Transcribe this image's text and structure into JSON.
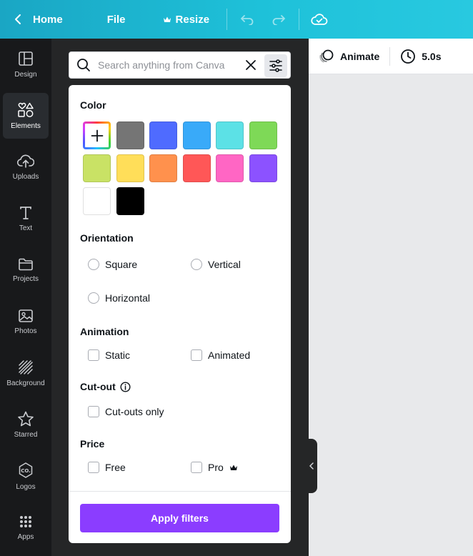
{
  "topbar": {
    "home_label": "Home",
    "file_label": "File",
    "resize_label": "Resize"
  },
  "rail": [
    {
      "label": "Design",
      "icon": "layout-icon",
      "active": false
    },
    {
      "label": "Elements",
      "icon": "shapes-icon",
      "active": true
    },
    {
      "label": "Uploads",
      "icon": "cloud-upload-icon",
      "active": false
    },
    {
      "label": "Text",
      "icon": "text-icon",
      "active": false
    },
    {
      "label": "Projects",
      "icon": "folder-icon",
      "active": false
    },
    {
      "label": "Photos",
      "icon": "image-icon",
      "active": false
    },
    {
      "label": "Background",
      "icon": "pattern-icon",
      "active": false
    },
    {
      "label": "Starred",
      "icon": "star-icon",
      "active": false
    },
    {
      "label": "Logos",
      "icon": "logo-icon",
      "active": false
    },
    {
      "label": "Apps",
      "icon": "grid-icon",
      "active": false
    }
  ],
  "search": {
    "placeholder": "Search anything from Canva",
    "value": ""
  },
  "filters": {
    "color": {
      "title": "Color",
      "swatches": [
        "#757575",
        "#4f6bff",
        "#39aaf9",
        "#5ce1e6",
        "#7ed957",
        "#c9e265",
        "#ffde59",
        "#ff914d",
        "#ff5757",
        "#ff66c4",
        "#8c52ff",
        "#ffffff",
        "#000000"
      ]
    },
    "orientation": {
      "title": "Orientation",
      "options": [
        "Square",
        "Vertical",
        "Horizontal"
      ]
    },
    "animation": {
      "title": "Animation",
      "options": [
        "Static",
        "Animated"
      ]
    },
    "cutout": {
      "title": "Cut-out",
      "options": [
        "Cut-outs only"
      ]
    },
    "price": {
      "title": "Price",
      "options": [
        "Free",
        "Pro"
      ]
    },
    "apply_label": "Apply filters"
  },
  "right": {
    "animate_label": "Animate",
    "duration_label": "5.0s"
  },
  "colors": {
    "accent": "#8b3dff",
    "topbar": "#1ec1d9"
  }
}
